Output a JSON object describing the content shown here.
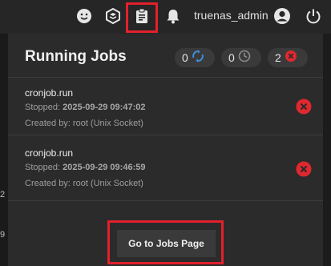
{
  "topbar": {
    "icons": [
      "smiley-icon",
      "truecommand-icon",
      "clipboard-icon",
      "bell-icon",
      "user-circle-icon",
      "power-icon"
    ],
    "username": "truenas_admin"
  },
  "left_strip_marks": [
    "2",
    "9"
  ],
  "jobs_panel": {
    "title": "Running Jobs",
    "counters": [
      {
        "count": "0",
        "icon": "sync-icon",
        "color": "#3b8fd9"
      },
      {
        "count": "0",
        "icon": "clock-icon",
        "color": "#8a8a8a"
      },
      {
        "count": "2",
        "icon": "failed-x-icon",
        "color": "#e0282f"
      }
    ],
    "jobs": [
      {
        "name": "cronjob.run",
        "stopped_label": "Stopped:",
        "stopped_value": "2025-09-29 09:47:02",
        "created_by": "Created by: root (Unix Socket)",
        "status": "failed"
      },
      {
        "name": "cronjob.run",
        "stopped_label": "Stopped:",
        "stopped_value": "2025-09-29 09:46:59",
        "created_by": "Created by: root (Unix Socket)",
        "status": "failed"
      }
    ],
    "go_button_label": "Go to Jobs Page"
  },
  "colors": {
    "highlight": "#e3202c",
    "error": "#e0282f",
    "accent": "#3b8fd9"
  }
}
